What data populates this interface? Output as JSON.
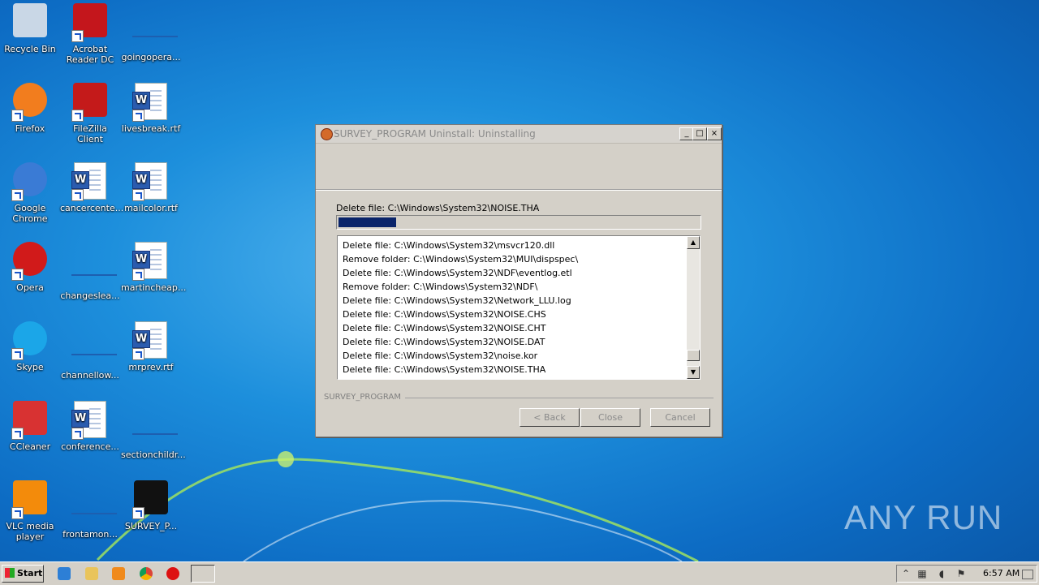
{
  "desktop": {
    "icons": [
      {
        "label": "Recycle Bin",
        "icon": "recycle-bin-icon"
      },
      {
        "label": "Acrobat Reader DC",
        "icon": "acrobat-icon"
      },
      {
        "label": "goingopera...",
        "icon": "file-icon"
      },
      {
        "label": "Firefox",
        "icon": "firefox-icon"
      },
      {
        "label": "FileZilla Client",
        "icon": "filezilla-icon"
      },
      {
        "label": "livesbreak.rtf",
        "icon": "word-doc-icon"
      },
      {
        "label": "Google Chrome",
        "icon": "chrome-icon"
      },
      {
        "label": "cancercente...",
        "icon": "word-doc-icon"
      },
      {
        "label": "mailcolor.rtf",
        "icon": "word-doc-icon"
      },
      {
        "label": "Opera",
        "icon": "opera-icon"
      },
      {
        "label": "changeslea...",
        "icon": "file-icon"
      },
      {
        "label": "martincheap...",
        "icon": "word-doc-icon"
      },
      {
        "label": "Skype",
        "icon": "skype-icon"
      },
      {
        "label": "channellow...",
        "icon": "file-icon"
      },
      {
        "label": "mrprev.rtf",
        "icon": "word-doc-icon"
      },
      {
        "label": "CCleaner",
        "icon": "ccleaner-icon"
      },
      {
        "label": "conference...",
        "icon": "word-doc-icon"
      },
      {
        "label": "sectionchildr...",
        "icon": "file-icon"
      },
      {
        "label": "VLC media player",
        "icon": "vlc-icon"
      },
      {
        "label": "frontamon...",
        "icon": "file-icon"
      },
      {
        "label": "SURVEY_P...",
        "icon": "survey-heart-icon"
      }
    ]
  },
  "window": {
    "title": "SURVEY_PROGRAM Uninstall: Uninstalling",
    "status_text": "Delete file: C:\\Windows\\System32\\NOISE.THA",
    "progress": 0.16,
    "log": [
      "Delete file: C:\\Windows\\System32\\msvcr120.dll",
      "Remove folder: C:\\Windows\\System32\\MUI\\dispspec\\",
      "Delete file: C:\\Windows\\System32\\NDF\\eventlog.etl",
      "Remove folder: C:\\Windows\\System32\\NDF\\",
      "Delete file: C:\\Windows\\System32\\Network_LLU.log",
      "Delete file: C:\\Windows\\System32\\NOISE.CHS",
      "Delete file: C:\\Windows\\System32\\NOISE.CHT",
      "Delete file: C:\\Windows\\System32\\NOISE.DAT",
      "Delete file: C:\\Windows\\System32\\noise.kor",
      "Delete file: C:\\Windows\\System32\\NOISE.THA"
    ],
    "brand": "SURVEY_PROGRAM",
    "buttons": {
      "back": "< Back",
      "close": "Close",
      "cancel": "Cancel"
    }
  },
  "watermark": "ANY RUN",
  "taskbar": {
    "start": "Start",
    "clock": "6:57 AM"
  }
}
